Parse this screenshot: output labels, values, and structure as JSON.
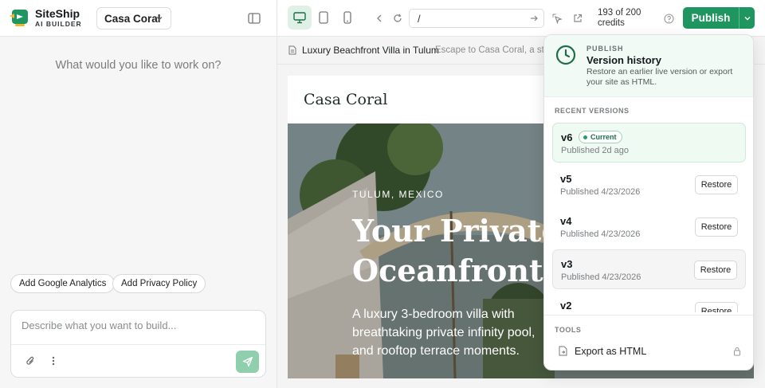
{
  "brand": {
    "name": "SiteShip",
    "tagline": "AI BUILDER",
    "color": "#1f9560"
  },
  "header": {
    "project": "Casa Coral",
    "url": "/",
    "credits_line1": "193 of 200",
    "credits_line2": "credits",
    "publish_label": "Publish"
  },
  "chat": {
    "prompt": "What would you like to work on?",
    "suggestions": [
      "Add Google Analytics",
      "Add Privacy Policy"
    ],
    "input_placeholder": "Describe what you want to build..."
  },
  "page_bar": {
    "title": "Luxury Beachfront Villa in Tulum",
    "description": "Escape to Casa Coral, a stunning"
  },
  "preview": {
    "site_logo": "Casa Coral",
    "eyebrow": "TULUM, MEXICO",
    "title_line1": "Your Private",
    "title_line2": "Oceanfront E",
    "body": "A luxury 3-bedroom villa with breathtaking private infinity pool, and rooftop terrace moments."
  },
  "publish_popover": {
    "eyebrow": "PUBLISH",
    "title": "Version history",
    "description": "Restore an earlier live version or export your site as HTML.",
    "recent_label": "RECENT VERSIONS",
    "versions": [
      {
        "name": "v6",
        "badge": "Current",
        "date": "Published 2d ago"
      },
      {
        "name": "v5",
        "date": "Published 4/23/2026",
        "action": "Restore"
      },
      {
        "name": "v4",
        "date": "Published 4/23/2026",
        "action": "Restore"
      },
      {
        "name": "v3",
        "date": "Published 4/23/2026",
        "action": "Restore"
      },
      {
        "name": "v2",
        "date": "",
        "action": "Restore"
      }
    ],
    "tools_label": "TOOLS",
    "export_label": "Export as HTML"
  }
}
